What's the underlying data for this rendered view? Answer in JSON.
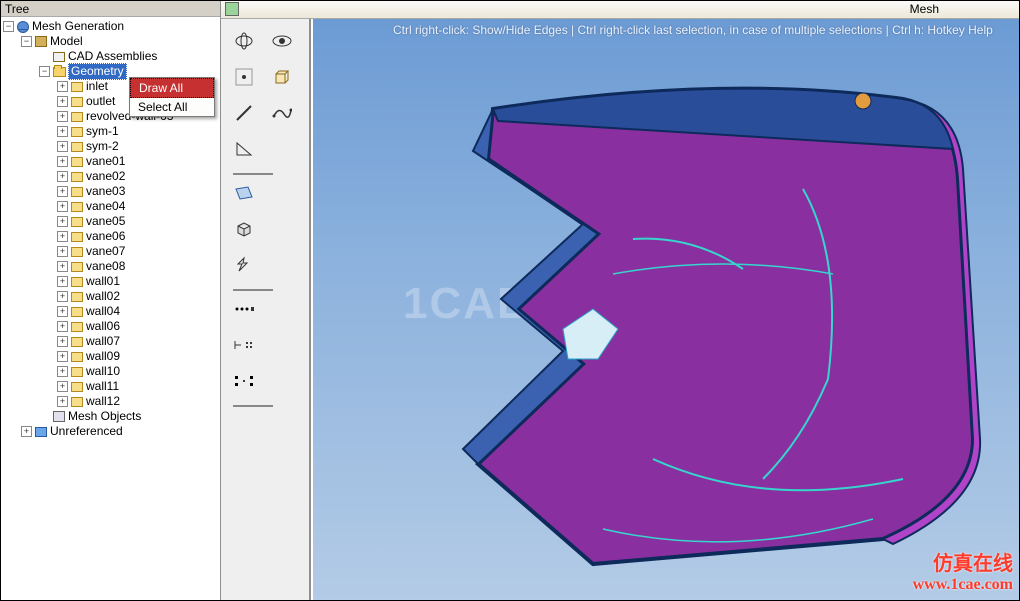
{
  "topbar": {
    "title": "Mesh"
  },
  "tree": {
    "title": "Tree",
    "root": {
      "label": "Mesh Generation",
      "model": {
        "label": "Model",
        "assemblies": {
          "label": "CAD Assemblies"
        },
        "geometry": {
          "label": "Geometry",
          "items": [
            "inlet",
            "outlet",
            "revolved-wall-63",
            "sym-1",
            "sym-2",
            "vane01",
            "vane02",
            "vane03",
            "vane04",
            "vane05",
            "vane06",
            "vane07",
            "vane08",
            "wall01",
            "wall02",
            "wall04",
            "wall06",
            "wall07",
            "wall09",
            "wall10",
            "wall11",
            "wall12"
          ]
        },
        "mesh_objects": {
          "label": "Mesh Objects"
        },
        "unreferenced": {
          "label": "Unreferenced"
        }
      }
    }
  },
  "context_menu": {
    "draw_all": "Draw All",
    "select_all": "Select All"
  },
  "hint_text": "Ctrl right-click: Show/Hide Edges | Ctrl right-click last selection, in case of multiple selections | Ctrl h: Hotkey Help",
  "watermark_center": "1CAE.COM",
  "watermark_brand": "仿真在线",
  "watermark_url": "www.1cae.com"
}
